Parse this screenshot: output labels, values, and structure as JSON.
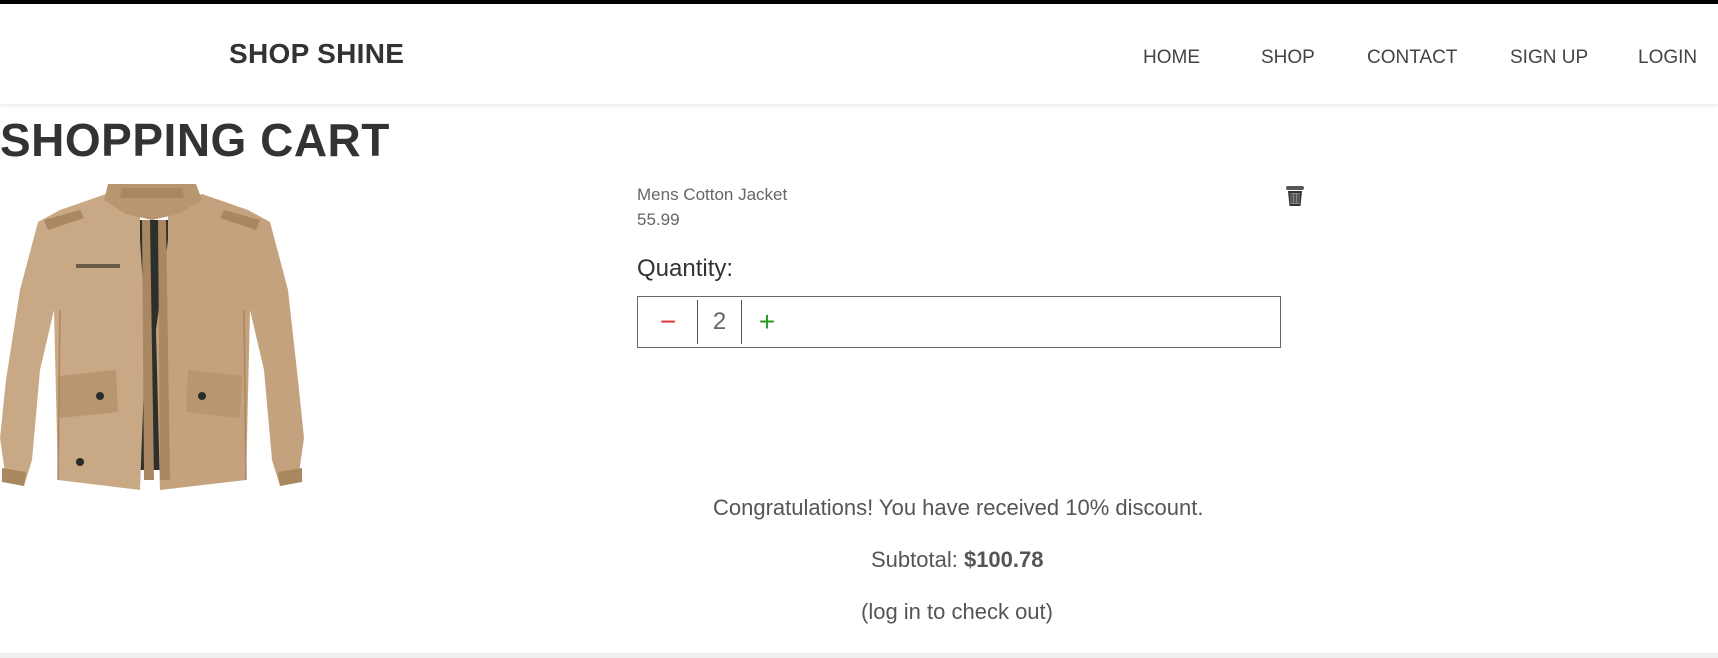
{
  "header": {
    "brand": "SHOP SHINE",
    "nav": {
      "home": "HOME",
      "shop": "SHOP",
      "contact": "CONTACT",
      "signup": "SIGN UP",
      "login": "LOGIN"
    }
  },
  "cart": {
    "title": "SHOPPING CART",
    "items": [
      {
        "name": "Mens Cotton Jacket",
        "price": "55.99",
        "quantity_label": "Quantity:",
        "quantity": "2",
        "minus_symbol": "−",
        "plus_symbol": "+",
        "image": "jacket-product-image",
        "remove_icon": "trash-icon"
      }
    ]
  },
  "summary": {
    "discount_message": "Congratulations! You have received 10% discount.",
    "subtotal_label": "Subtotal:",
    "subtotal_value": "$100.78",
    "checkout_note": "(log in to check out)"
  },
  "colors": {
    "minus": "#dd3333",
    "plus": "#2a9a2a",
    "text_dark": "#333333",
    "text_muted": "#666666"
  }
}
